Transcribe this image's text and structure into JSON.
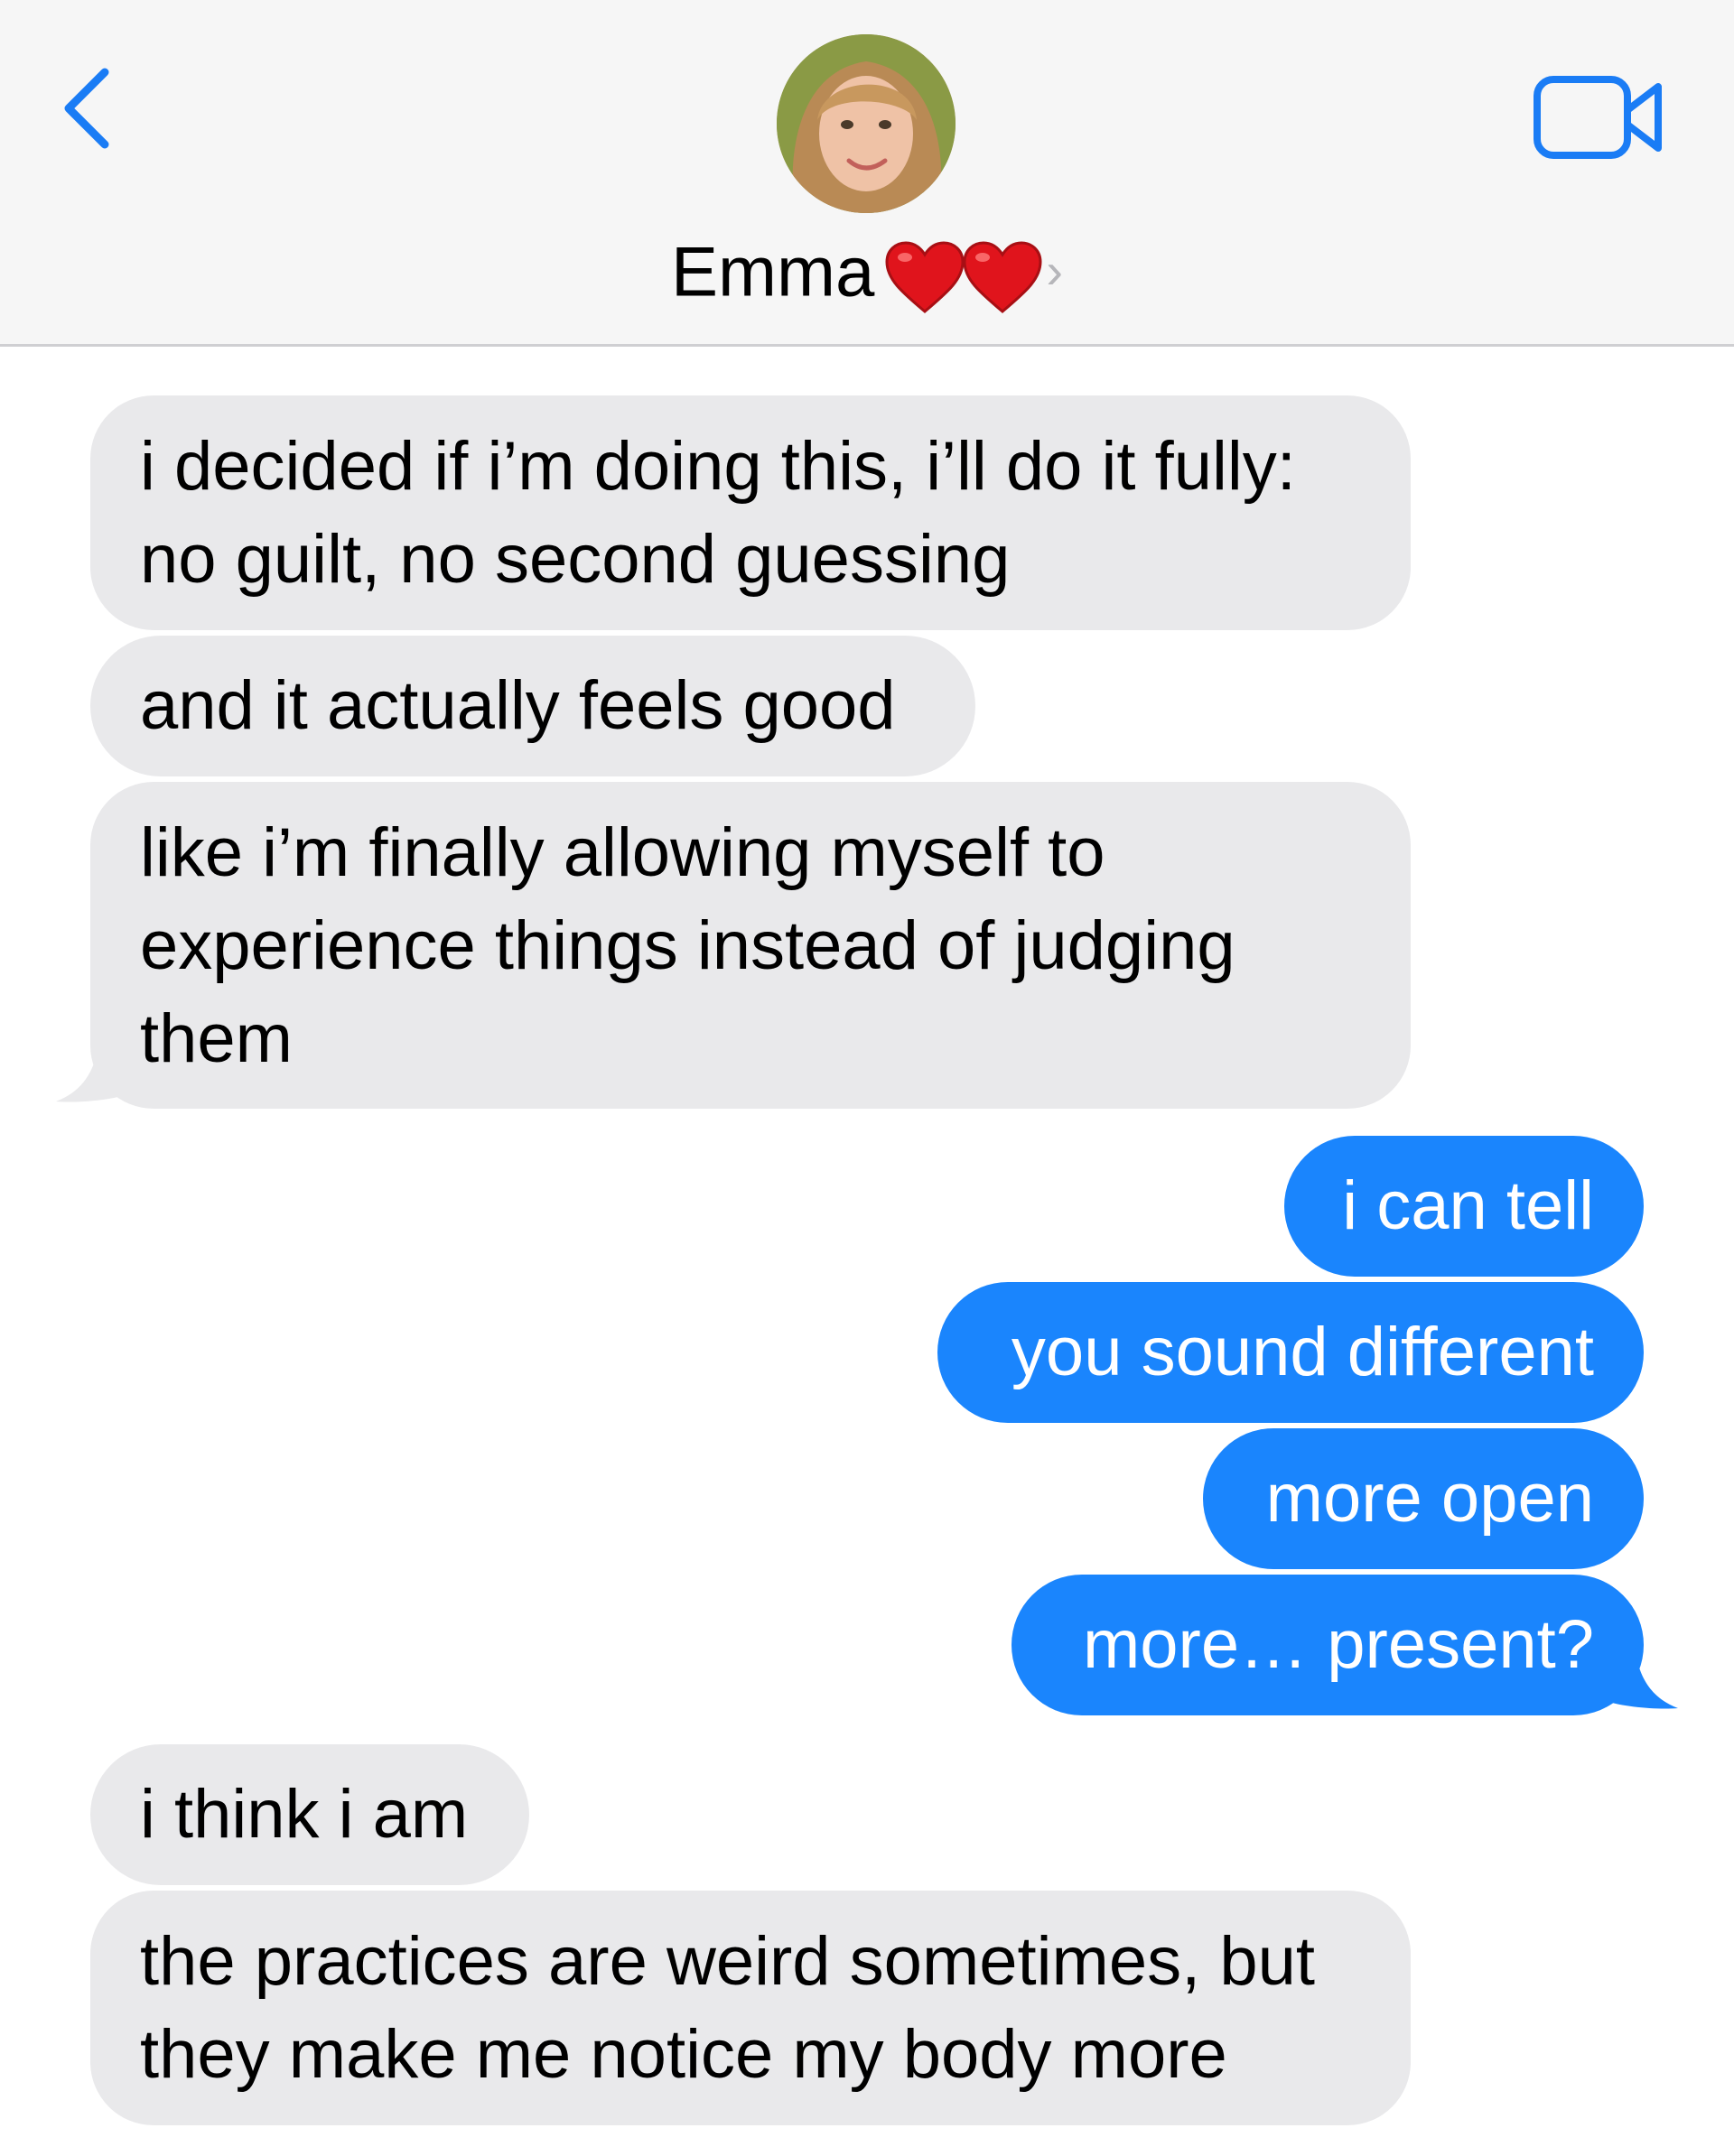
{
  "header": {
    "contact_name": "Emma",
    "contact_suffix": "❤️❤️",
    "back_icon": "chevron-left-icon",
    "video_icon": "video-camera-icon",
    "accent_color": "#1a7cf5"
  },
  "messages": [
    {
      "side": "in",
      "lines": [
        "i decided if i’m doing this, i’ll do it fully:",
        "no guilt, no second guessing"
      ]
    },
    {
      "side": "in",
      "lines": [
        "and it actually feels good"
      ]
    },
    {
      "side": "in",
      "lines": [
        "like i’m finally allowing myself to",
        "experience things instead of judging",
        "them"
      ]
    },
    {
      "side": "out",
      "lines": [
        "i can tell"
      ]
    },
    {
      "side": "out",
      "lines": [
        "you sound different"
      ]
    },
    {
      "side": "out",
      "lines": [
        "more open"
      ]
    },
    {
      "side": "out",
      "lines": [
        "more… present?"
      ]
    },
    {
      "side": "in",
      "lines": [
        "i think i am"
      ]
    },
    {
      "side": "in",
      "lines": [
        "the practices are weird sometimes, but",
        "they make me notice my body more"
      ]
    }
  ],
  "colors": {
    "incoming_bubble": "#e9e9eb",
    "outgoing_bubble": "#1a85fd",
    "header_bg": "#f6f6f6"
  }
}
